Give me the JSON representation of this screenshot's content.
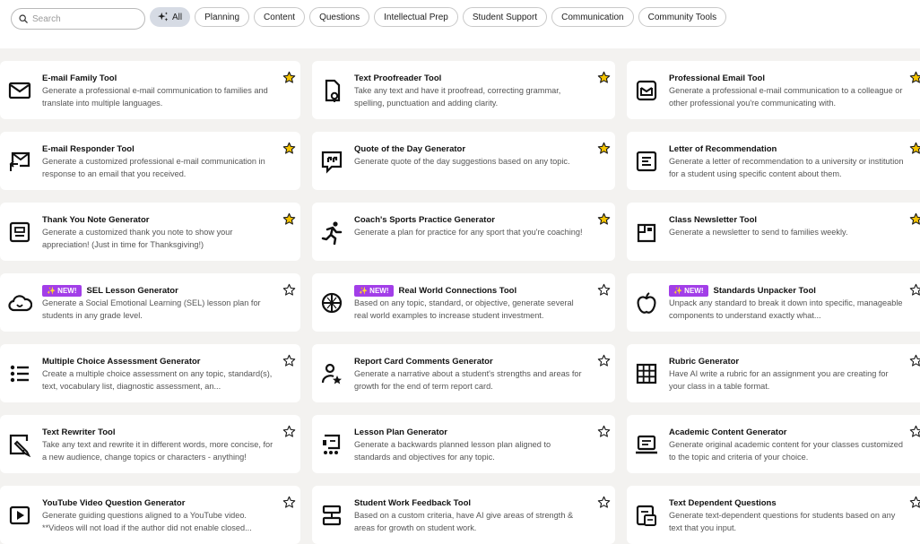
{
  "search": {
    "placeholder": "Search",
    "value": ""
  },
  "filters": [
    "All",
    "Planning",
    "Content",
    "Questions",
    "Intellectual Prep",
    "Student Support",
    "Communication",
    "Community Tools"
  ],
  "active_filter": "All",
  "badge_label": "✨ NEW!",
  "colors": {
    "star_fill": "#f5c400",
    "badge": "#a23ee8",
    "active_chip": "#d6dbe4"
  },
  "tools": [
    {
      "icon": "mail-icon",
      "title": "E-mail Family Tool",
      "desc": "Generate a professional e-mail communication to families and translate into multiple languages.",
      "favorite": true,
      "new": false
    },
    {
      "icon": "document-search-icon",
      "title": "Text Proofreader Tool",
      "desc": "Take any text and have it proofread, correcting grammar, spelling, punctuation and adding clarity.",
      "favorite": true,
      "new": false
    },
    {
      "icon": "mail-box-icon",
      "title": "Professional Email Tool",
      "desc": "Generate a professional e-mail communication to a colleague or other professional you're communicating with.",
      "favorite": true,
      "new": false
    },
    {
      "icon": "mail-reply-icon",
      "title": "E-mail Responder Tool",
      "desc": "Generate a customized professional e-mail communication in response to an email that you received.",
      "favorite": true,
      "new": false
    },
    {
      "icon": "quote-icon",
      "title": "Quote of the Day Generator",
      "desc": "Generate quote of the day suggestions based on any topic.",
      "favorite": true,
      "new": false
    },
    {
      "icon": "letter-icon",
      "title": "Letter of Recommendation",
      "desc": "Generate a letter of recommendation to a university or institution for a student using specific content about them.",
      "favorite": true,
      "new": false
    },
    {
      "icon": "card-icon",
      "title": "Thank You Note Generator",
      "desc": "Generate a customized thank you note to show your appreciation! (Just in time for Thanksgiving!)",
      "favorite": true,
      "new": false
    },
    {
      "icon": "runner-icon",
      "title": "Coach's Sports Practice Generator",
      "desc": "Generate a plan for practice for any sport that you're coaching!",
      "favorite": true,
      "new": false
    },
    {
      "icon": "newspaper-icon",
      "title": "Class Newsletter Tool",
      "desc": "Generate a newsletter to send to families weekly.",
      "favorite": true,
      "new": false
    },
    {
      "icon": "cloud-smile-icon",
      "title": "SEL Lesson Generator",
      "desc": "Generate a Social Emotional Learning (SEL) lesson plan for students in any grade level.",
      "favorite": false,
      "new": true
    },
    {
      "icon": "globe-icon",
      "title": "Real World Connections Tool",
      "desc": "Based on any topic, standard, or objective, generate several real world examples to increase student investment.",
      "favorite": false,
      "new": true
    },
    {
      "icon": "apple-icon",
      "title": "Standards Unpacker Tool",
      "desc": "Unpack any standard to break it down into specific, manageable components to understand exactly what...",
      "favorite": false,
      "new": true
    },
    {
      "icon": "list-icon",
      "title": "Multiple Choice Assessment Generator",
      "desc": "Create a multiple choice assessment on any topic, standard(s), text, vocabulary list, diagnostic assessment, an...",
      "favorite": false,
      "new": false
    },
    {
      "icon": "user-star-icon",
      "title": "Report Card Comments Generator",
      "desc": "Generate a narrative about a student's strengths and areas for growth for the end of term report card.",
      "favorite": false,
      "new": false
    },
    {
      "icon": "table-grid-icon",
      "title": "Rubric Generator",
      "desc": "Have AI write a rubric for an assignment you are creating for your class in a table format.",
      "favorite": false,
      "new": false
    },
    {
      "icon": "pencil-document-icon",
      "title": "Text Rewriter Tool",
      "desc": "Take any text and rewrite it in different words, more concise, for a new audience, change topics or characters - anything!",
      "favorite": false,
      "new": false
    },
    {
      "icon": "lesson-board-icon",
      "title": "Lesson Plan Generator",
      "desc": "Generate a backwards planned lesson plan aligned to standards and objectives for any topic.",
      "favorite": false,
      "new": false
    },
    {
      "icon": "laptop-icon",
      "title": "Academic Content Generator",
      "desc": "Generate original academic content for your classes customized to the topic and criteria of your choice.",
      "favorite": false,
      "new": false
    },
    {
      "icon": "play-icon",
      "title": "YouTube Video Question Generator",
      "desc": "Generate guiding questions aligned to a YouTube video. **Videos will not load if the author did not enable closed...",
      "favorite": false,
      "new": false
    },
    {
      "icon": "stack-icon",
      "title": "Student Work Feedback Tool",
      "desc": "Based on a custom criteria, have AI give areas of strength & areas for growth on student work.",
      "favorite": false,
      "new": false
    },
    {
      "icon": "text-document-icon",
      "title": "Text Dependent Questions",
      "desc": "Generate text-dependent questions for students based on any text that you input.",
      "favorite": false,
      "new": false
    }
  ]
}
